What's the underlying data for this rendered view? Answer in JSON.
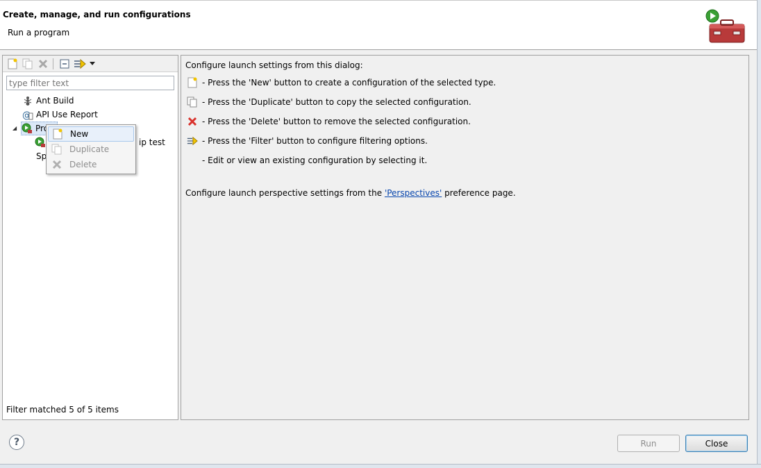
{
  "header": {
    "title": "Create, manage, and run configurations",
    "subtitle": "Run a program"
  },
  "filter": {
    "placeholder": "type filter text",
    "status": "Filter matched 5 of 5 items"
  },
  "tree": {
    "items": [
      {
        "label": "Ant Build",
        "icon": "ant-icon"
      },
      {
        "label": "API Use Report",
        "icon": "api-report-icon"
      },
      {
        "label": "Pro",
        "icon": "program-icon"
      },
      {
        "label": "ip test",
        "icon": "program-child-icon"
      },
      {
        "label": "Sp",
        "icon": "none"
      }
    ]
  },
  "context_menu": {
    "items": [
      {
        "label": "New",
        "state": "hover"
      },
      {
        "label": "Duplicate",
        "state": "disabled"
      },
      {
        "label": "Delete",
        "state": "disabled"
      }
    ]
  },
  "right_panel": {
    "intro": "Configure launch settings from this dialog:",
    "lines": [
      {
        "text": "- Press the 'New' button to create a configuration of the selected type.",
        "icon": "new-config-icon"
      },
      {
        "text": "- Press the 'Duplicate' button to copy the selected configuration.",
        "icon": "duplicate-icon"
      },
      {
        "text": "- Press the 'Delete' button to remove the selected configuration.",
        "icon": "delete-icon"
      },
      {
        "text": "- Press the 'Filter' button to configure filtering options.",
        "icon": "filter-icon"
      },
      {
        "text": "- Edit or view an existing configuration by selecting it.",
        "icon": "none"
      }
    ],
    "perspective_prefix": "Configure launch perspective settings from the ",
    "perspective_link": "'Perspectives'",
    "perspective_suffix": " preference page."
  },
  "buttons": {
    "run": "Run",
    "close": "Close",
    "help": "?"
  },
  "colors": {
    "link": "#0645ad",
    "accent": "#3c7fb1",
    "delete_red": "#d9312b"
  }
}
